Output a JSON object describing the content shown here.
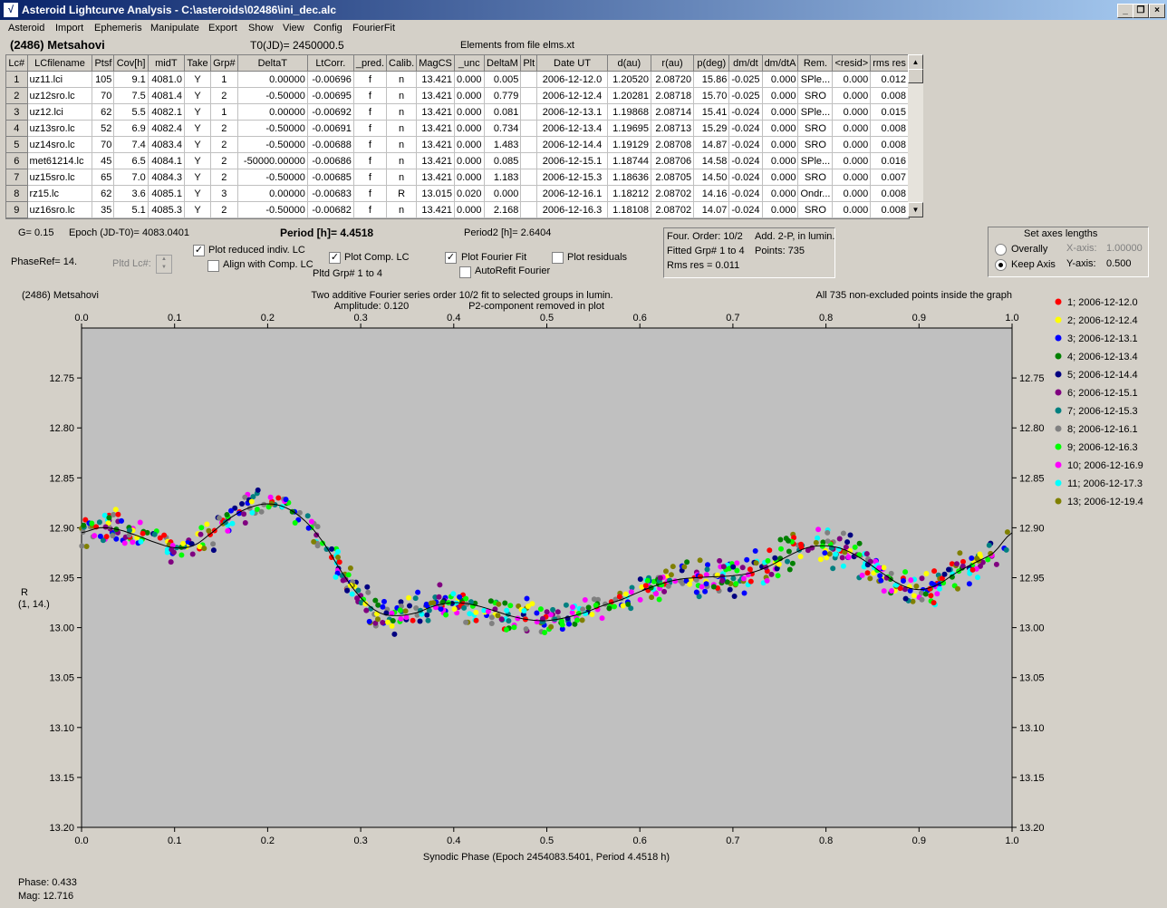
{
  "window": {
    "title": "Asteroid Lightcurve Analysis - C:\\asteroids\\02486\\ini_dec.alc"
  },
  "menu": [
    "Asteroid",
    "Import",
    "Ephemeris",
    "Manipulate",
    "Export",
    "Show",
    "View",
    "Config",
    "FourierFit"
  ],
  "header": {
    "object": "(2486) Metsahovi",
    "t0": "T0(JD)= 2450000.5",
    "elements": "Elements from file elms.xt"
  },
  "table": {
    "columns": [
      "Lc#",
      "LCfilename",
      "Ptsf",
      "Cov[h]",
      "midT",
      "Take",
      "Grp#",
      "DeltaT",
      "LtCorr.",
      "_pred.",
      "Calib.",
      "MagCS",
      "_unc",
      "DeltaM",
      "Plt",
      "Date UT",
      "d(au)",
      "r(au)",
      "p(deg)",
      "dm/dt",
      "dm/dtA",
      "Rem.",
      "<resid>",
      "rms res"
    ],
    "rows": [
      [
        "1",
        "uz11.lci",
        "105",
        "9.1",
        "4081.0",
        "Y",
        "1",
        "0.00000",
        "-0.00696",
        "f",
        "n",
        "13.421",
        "0.000",
        "0.005",
        "",
        "2006-12-12.0",
        "1.20520",
        "2.08720",
        "15.86",
        "-0.025",
        "0.000",
        "SPle...",
        "0.000",
        "0.012"
      ],
      [
        "2",
        "uz12sro.lc",
        "70",
        "7.5",
        "4081.4",
        "Y",
        "2",
        "-0.50000",
        "-0.00695",
        "f",
        "n",
        "13.421",
        "0.000",
        "0.779",
        "",
        "2006-12-12.4",
        "1.20281",
        "2.08718",
        "15.70",
        "-0.025",
        "0.000",
        "SRO",
        "0.000",
        "0.008"
      ],
      [
        "3",
        "uz12.lci",
        "62",
        "5.5",
        "4082.1",
        "Y",
        "1",
        "0.00000",
        "-0.00692",
        "f",
        "n",
        "13.421",
        "0.000",
        "0.081",
        "",
        "2006-12-13.1",
        "1.19868",
        "2.08714",
        "15.41",
        "-0.024",
        "0.000",
        "SPle...",
        "0.000",
        "0.015"
      ],
      [
        "4",
        "uz13sro.lc",
        "52",
        "6.9",
        "4082.4",
        "Y",
        "2",
        "-0.50000",
        "-0.00691",
        "f",
        "n",
        "13.421",
        "0.000",
        "0.734",
        "",
        "2006-12-13.4",
        "1.19695",
        "2.08713",
        "15.29",
        "-0.024",
        "0.000",
        "SRO",
        "0.000",
        "0.008"
      ],
      [
        "5",
        "uz14sro.lc",
        "70",
        "7.4",
        "4083.4",
        "Y",
        "2",
        "-0.50000",
        "-0.00688",
        "f",
        "n",
        "13.421",
        "0.000",
        "1.483",
        "",
        "2006-12-14.4",
        "1.19129",
        "2.08708",
        "14.87",
        "-0.024",
        "0.000",
        "SRO",
        "0.000",
        "0.008"
      ],
      [
        "6",
        "met61214.lc",
        "45",
        "6.5",
        "4084.1",
        "Y",
        "2",
        "-50000.00000",
        "-0.00686",
        "f",
        "n",
        "13.421",
        "0.000",
        "0.085",
        "",
        "2006-12-15.1",
        "1.18744",
        "2.08706",
        "14.58",
        "-0.024",
        "0.000",
        "SPle...",
        "0.000",
        "0.016"
      ],
      [
        "7",
        "uz15sro.lc",
        "65",
        "7.0",
        "4084.3",
        "Y",
        "2",
        "-0.50000",
        "-0.00685",
        "f",
        "n",
        "13.421",
        "0.000",
        "1.183",
        "",
        "2006-12-15.3",
        "1.18636",
        "2.08705",
        "14.50",
        "-0.024",
        "0.000",
        "SRO",
        "0.000",
        "0.007"
      ],
      [
        "8",
        "rz15.lc",
        "62",
        "3.6",
        "4085.1",
        "Y",
        "3",
        "0.00000",
        "-0.00683",
        "f",
        "R",
        "13.015",
        "0.020",
        "0.000",
        "",
        "2006-12-16.1",
        "1.18212",
        "2.08702",
        "14.16",
        "-0.024",
        "0.000",
        "Ondr...",
        "0.000",
        "0.008"
      ],
      [
        "9",
        "uz16sro.lc",
        "35",
        "5.1",
        "4085.3",
        "Y",
        "2",
        "-0.50000",
        "-0.00682",
        "f",
        "n",
        "13.421",
        "0.000",
        "2.168",
        "",
        "2006-12-16.3",
        "1.18108",
        "2.08702",
        "14.07",
        "-0.024",
        "0.000",
        "SRO",
        "0.000",
        "0.008"
      ]
    ]
  },
  "controls": {
    "g": "G= 0.15",
    "epoch": "Epoch (JD-T0)= 4083.0401",
    "period": "Period [h]= 4.4518",
    "period2": "Period2 [h]= 2.6404",
    "phaseref": "PhaseRef= 14.",
    "pltd_lc": "Pltd Lc#:",
    "plot_reduced": "Plot reduced indiv. LC",
    "align": "Align with Comp. LC",
    "plot_comp": "Plot Comp. LC",
    "pltd_grp": "Pltd Grp#  1   to   4",
    "plot_fourier": "Plot Fourier Fit",
    "autorefit": "AutoRefit Fourier",
    "plot_resid": "Plot residuals"
  },
  "info": {
    "four_order": "Four. Order: 10/2",
    "add": "Add. 2-P, in lumin.",
    "fitted": "Fitted Grp# 1 to 4",
    "points": "Points: 735",
    "rms": "Rms res     = 0.011"
  },
  "axes_box": {
    "title": "Set axes lengths",
    "overally": "Overally",
    "keep": "Keep Axis",
    "xaxis_label": "X-axis:",
    "xaxis_val": "1.00000",
    "yaxis_label": "Y-axis:",
    "yaxis_val": "0.500"
  },
  "status": {
    "phase": "Phase:  0.433",
    "mag": "Mag:    12.716"
  },
  "chart_data": {
    "type": "scatter",
    "object_label": "(2486) Metsahovi",
    "title_line1": "Two additive Fourier series order 10/2 fit to selected groups in lumin.",
    "title_line2": "Amplitude: 0.120",
    "title_line3": "P2-component removed in plot",
    "note": "All 735 non-excluded points inside the graph",
    "xlabel": "Synodic Phase (Epoch 2454083.5401, Period 4.4518 h)",
    "ylabel": "R",
    "ylabel2": "(1, 14.)",
    "xlim": [
      0,
      1
    ],
    "ylim": [
      12.7,
      13.2
    ],
    "y_inverted": true,
    "xticks": [
      "0.0",
      "0.1",
      "0.2",
      "0.3",
      "0.4",
      "0.5",
      "0.6",
      "0.7",
      "0.8",
      "0.9",
      "1.0"
    ],
    "yticks": [
      "12.75",
      "12.80",
      "12.85",
      "12.90",
      "12.95",
      "13.00",
      "13.05",
      "13.10",
      "13.15",
      "13.20"
    ],
    "series": [
      {
        "name": "1; 2006-12-12.0",
        "color": "#ff0000"
      },
      {
        "name": "2; 2006-12-12.4",
        "color": "#ffff00"
      },
      {
        "name": "3; 2006-12-13.1",
        "color": "#0000ff"
      },
      {
        "name": "4; 2006-12-13.4",
        "color": "#008000"
      },
      {
        "name": "5; 2006-12-14.4",
        "color": "#000080"
      },
      {
        "name": "6; 2006-12-15.1",
        "color": "#800080"
      },
      {
        "name": "7; 2006-12-15.3",
        "color": "#008080"
      },
      {
        "name": "8; 2006-12-16.1",
        "color": "#808080"
      },
      {
        "name": "9; 2006-12-16.3",
        "color": "#00ff00"
      },
      {
        "name": "10; 2006-12-16.9",
        "color": "#ff00ff"
      },
      {
        "name": "11; 2006-12-17.3",
        "color": "#00ffff"
      },
      {
        "name": "13; 2006-12-19.4",
        "color": "#808000"
      }
    ],
    "fit_curve": [
      [
        0.0,
        12.905
      ],
      [
        0.02,
        12.9
      ],
      [
        0.04,
        12.902
      ],
      [
        0.06,
        12.908
      ],
      [
        0.08,
        12.915
      ],
      [
        0.1,
        12.92
      ],
      [
        0.12,
        12.918
      ],
      [
        0.14,
        12.905
      ],
      [
        0.16,
        12.89
      ],
      [
        0.18,
        12.88
      ],
      [
        0.2,
        12.876
      ],
      [
        0.22,
        12.88
      ],
      [
        0.24,
        12.893
      ],
      [
        0.26,
        12.915
      ],
      [
        0.28,
        12.945
      ],
      [
        0.3,
        12.97
      ],
      [
        0.32,
        12.985
      ],
      [
        0.34,
        12.988
      ],
      [
        0.36,
        12.985
      ],
      [
        0.38,
        12.978
      ],
      [
        0.4,
        12.975
      ],
      [
        0.42,
        12.977
      ],
      [
        0.44,
        12.982
      ],
      [
        0.46,
        12.988
      ],
      [
        0.48,
        12.992
      ],
      [
        0.5,
        12.993
      ],
      [
        0.52,
        12.99
      ],
      [
        0.54,
        12.985
      ],
      [
        0.56,
        12.978
      ],
      [
        0.58,
        12.972
      ],
      [
        0.6,
        12.964
      ],
      [
        0.62,
        12.957
      ],
      [
        0.64,
        12.952
      ],
      [
        0.66,
        12.95
      ],
      [
        0.68,
        12.949
      ],
      [
        0.7,
        12.948
      ],
      [
        0.72,
        12.945
      ],
      [
        0.74,
        12.938
      ],
      [
        0.76,
        12.928
      ],
      [
        0.78,
        12.92
      ],
      [
        0.8,
        12.918
      ],
      [
        0.82,
        12.922
      ],
      [
        0.84,
        12.932
      ],
      [
        0.86,
        12.945
      ],
      [
        0.88,
        12.957
      ],
      [
        0.9,
        12.962
      ],
      [
        0.92,
        12.957
      ],
      [
        0.94,
        12.945
      ],
      [
        0.96,
        12.935
      ],
      [
        0.98,
        12.925
      ],
      [
        1.0,
        12.905
      ]
    ]
  }
}
